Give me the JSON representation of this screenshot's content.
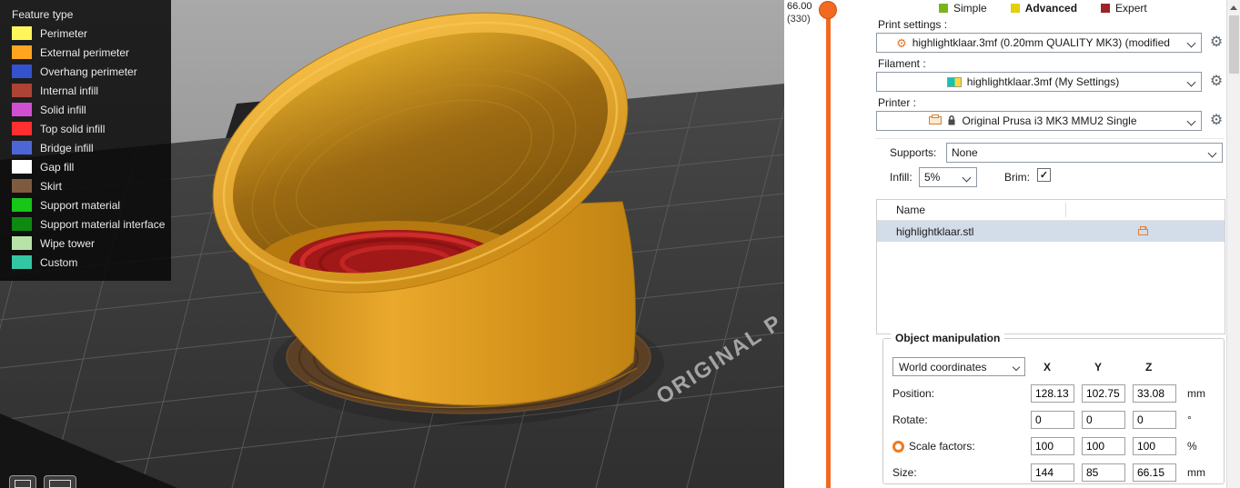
{
  "legend": {
    "title": "Feature type",
    "items": [
      {
        "label": "Perimeter",
        "color": "#FFF65B"
      },
      {
        "label": "External perimeter",
        "color": "#FFA51F"
      },
      {
        "label": "Overhang perimeter",
        "color": "#3352CC"
      },
      {
        "label": "Internal infill",
        "color": "#AD4334"
      },
      {
        "label": "Solid infill",
        "color": "#D04FD0"
      },
      {
        "label": "Top solid infill",
        "color": "#FF2F2F"
      },
      {
        "label": "Bridge infill",
        "color": "#4D66D6"
      },
      {
        "label": "Gap fill",
        "color": "#FFFFFF"
      },
      {
        "label": "Skirt",
        "color": "#7E5B3F"
      },
      {
        "label": "Support material",
        "color": "#17C617"
      },
      {
        "label": "Support material interface",
        "color": "#0E8A12"
      },
      {
        "label": "Wipe tower",
        "color": "#B8E3A8"
      },
      {
        "label": "Custom",
        "color": "#33C6A3"
      }
    ]
  },
  "viewport": {
    "bed_label": "ORIGINAL P"
  },
  "slider": {
    "value": "66.00",
    "layer": "(330)",
    "accent": "#f06a21"
  },
  "modes": {
    "items": [
      {
        "label": "Simple",
        "color": "#7AB41C"
      },
      {
        "label": "Advanced",
        "color": "#E3CF0E"
      },
      {
        "label": "Expert",
        "color": "#9D222A"
      }
    ]
  },
  "print_settings": {
    "label": "Print settings :",
    "value": "highlightklaar.3mf (0.20mm QUALITY MK3) (modified"
  },
  "filament": {
    "label": "Filament :",
    "value": "highlightklaar.3mf (My Settings)",
    "swatch_css": "linear-gradient(90deg,#14c3b4 0 55%,#ffd83e 55% 100%)"
  },
  "printer": {
    "label": "Printer :",
    "value": "Original Prusa i3 MK3 MMU2 Single"
  },
  "options": {
    "supports_label": "Supports:",
    "supports_value": "None",
    "infill_label": "Infill:",
    "infill_value": "5%",
    "brim_label": "Brim:",
    "brim_checked": true
  },
  "object_list": {
    "header": "Name",
    "rows": [
      {
        "name": "highlightklaar.stl"
      }
    ]
  },
  "manipulation": {
    "title": "Object manipulation",
    "coords_value": "World coordinates",
    "axes": [
      "X",
      "Y",
      "Z"
    ],
    "rows": [
      {
        "label": "Position:",
        "values": [
          "128.13",
          "102.75",
          "33.08"
        ],
        "unit": "mm"
      },
      {
        "label": "Rotate:",
        "values": [
          "0",
          "0",
          "0"
        ],
        "unit": "°"
      },
      {
        "label": "Scale factors:",
        "values": [
          "100",
          "100",
          "100"
        ],
        "unit": "%"
      },
      {
        "label": "Size:",
        "values": [
          "144",
          "85",
          "66.15"
        ],
        "unit": "mm"
      }
    ]
  },
  "icons": {
    "gear": "⚙",
    "check": "✓"
  },
  "colors": {
    "accent": "#f06a21",
    "selection": "#d3dce9",
    "model_orange": "#DD9C20",
    "skirt_brown": "#5C4026",
    "top_infill_red": "#B01F1F",
    "bed_dark": "#3E3E3E"
  }
}
